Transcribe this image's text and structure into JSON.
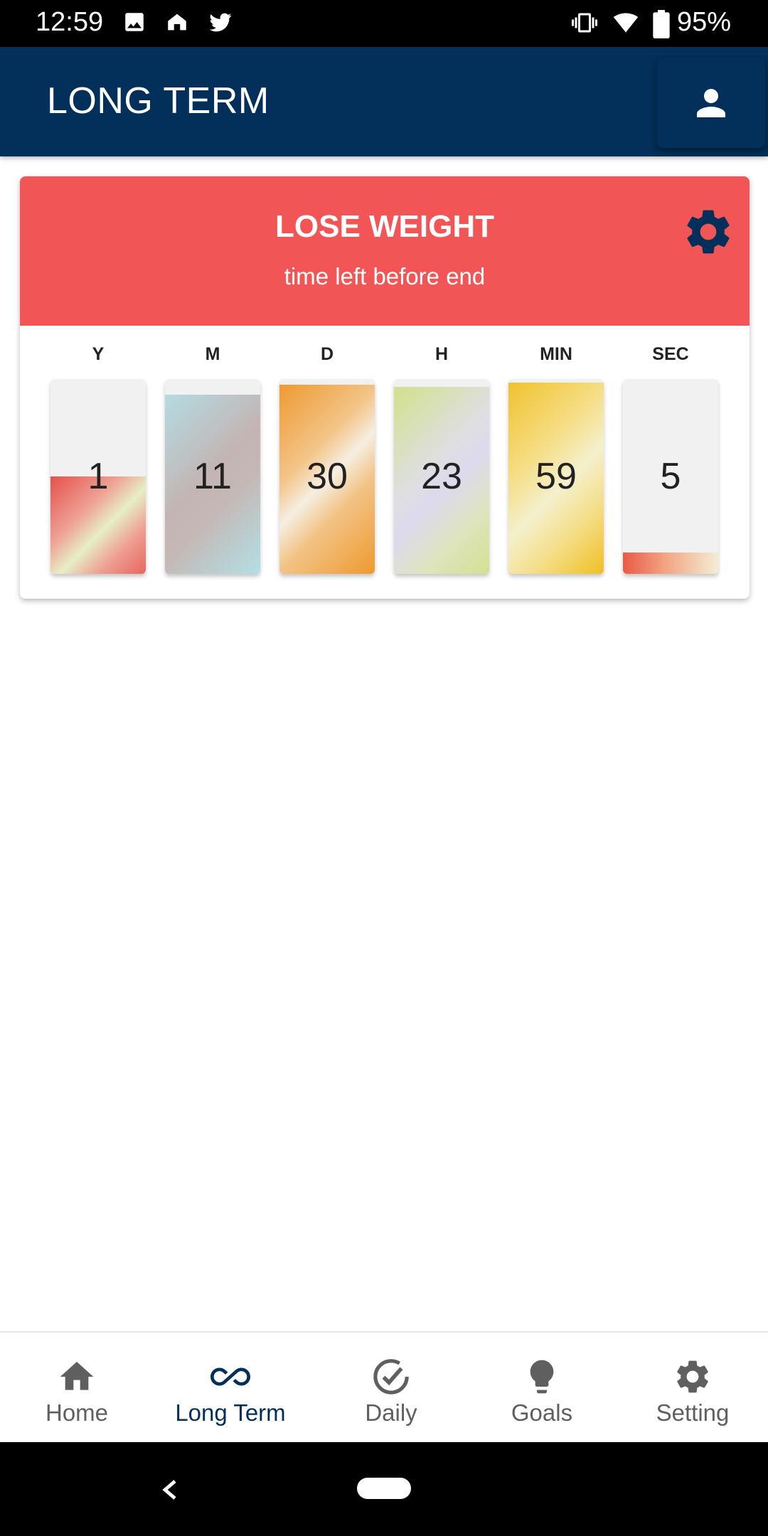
{
  "status_bar": {
    "time": "12:59",
    "battery": "95%"
  },
  "app_bar": {
    "title": "LONG TERM"
  },
  "goal": {
    "title": "LOSE WEIGHT",
    "subtitle": "time left before end",
    "units": [
      {
        "label": "Y",
        "value": "1",
        "fill": 0.5
      },
      {
        "label": "M",
        "value": "11",
        "fill": 0.92
      },
      {
        "label": "D",
        "value": "30",
        "fill": 0.97
      },
      {
        "label": "H",
        "value": "23",
        "fill": 0.96
      },
      {
        "label": "MIN",
        "value": "59",
        "fill": 0.98
      },
      {
        "label": "SEC",
        "value": "5",
        "fill": 0.11
      }
    ]
  },
  "bottom_nav": {
    "items": [
      {
        "label": "Home",
        "icon": "home-icon"
      },
      {
        "label": "Long Term",
        "icon": "infinity-icon",
        "active": true
      },
      {
        "label": "Daily",
        "icon": "check-circle-icon"
      },
      {
        "label": "Goals",
        "icon": "lightbulb-icon"
      },
      {
        "label": "Setting",
        "icon": "gear-icon"
      }
    ]
  },
  "colors": {
    "app_bar": "#02305a",
    "card_header": "#f25556",
    "nav_active": "#02305a",
    "nav_inactive": "#5f5f5f"
  }
}
